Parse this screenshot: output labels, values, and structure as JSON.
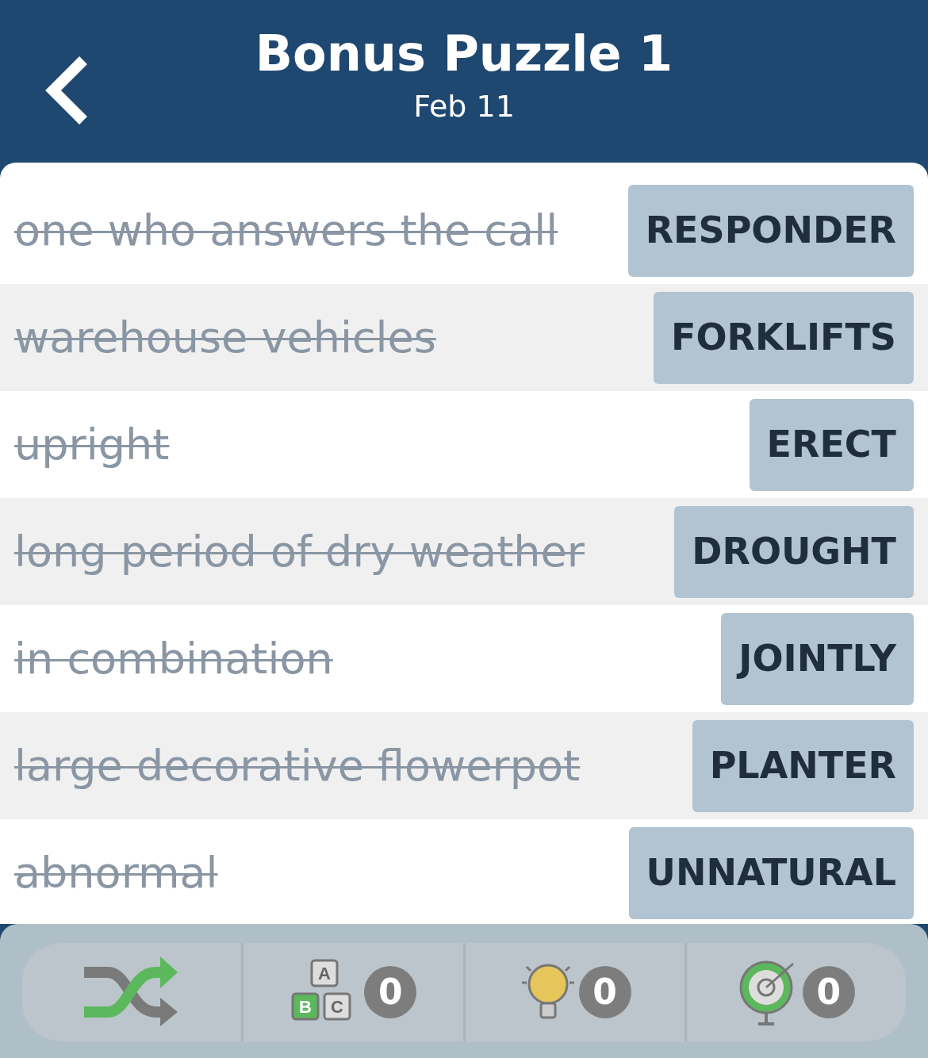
{
  "header": {
    "title": "Bonus Puzzle 1",
    "subtitle": "Feb 11"
  },
  "clues": [
    {
      "clue": "one who answers the call",
      "answer": "RESPONDER",
      "solved": true
    },
    {
      "clue": "warehouse vehicles",
      "answer": "FORKLIFTS",
      "solved": true
    },
    {
      "clue": "upright",
      "answer": "ERECT",
      "solved": true
    },
    {
      "clue": "long period of dry weather",
      "answer": "DROUGHT",
      "solved": true
    },
    {
      "clue": "in combination",
      "answer": "JOINTLY",
      "solved": true
    },
    {
      "clue": "large decorative flowerpot",
      "answer": "PLANTER",
      "solved": true
    },
    {
      "clue": "abnormal",
      "answer": "UNNATURAL",
      "solved": true
    }
  ],
  "toolbar": [
    {
      "kind": "shuffle"
    },
    {
      "kind": "letters",
      "letters": [
        "A",
        "B",
        "C"
      ],
      "count": "0"
    },
    {
      "kind": "hint",
      "count": "0"
    },
    {
      "kind": "target",
      "count": "0"
    }
  ]
}
